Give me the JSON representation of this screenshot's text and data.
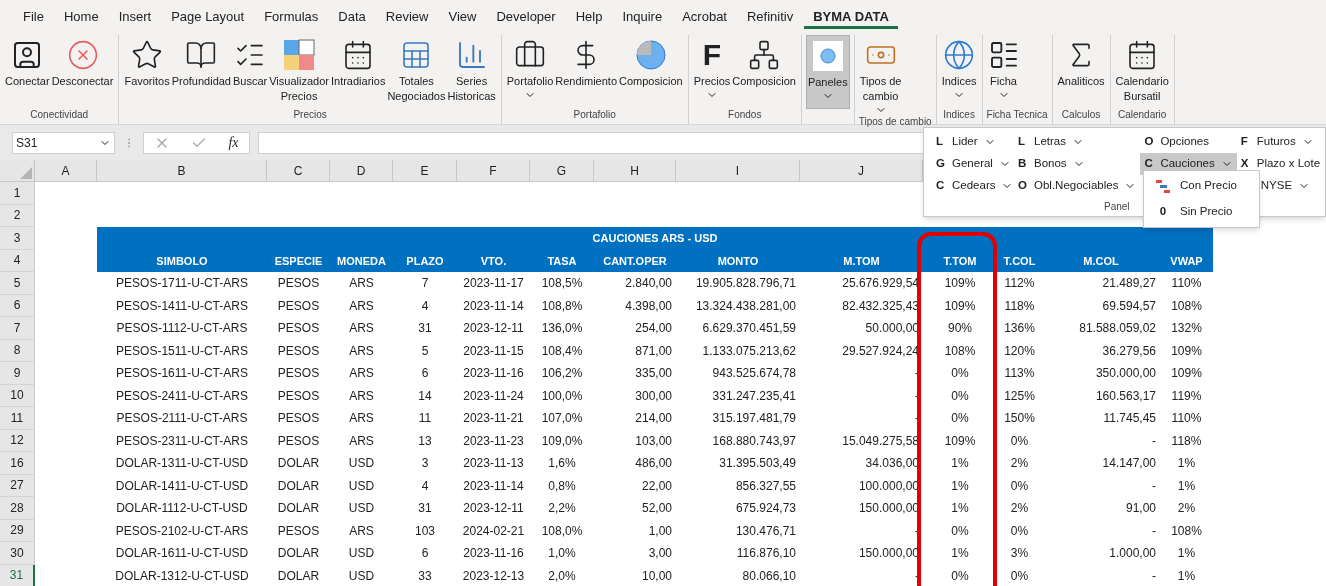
{
  "menu_tabs": [
    {
      "label": "File",
      "selected": false
    },
    {
      "label": "Home",
      "selected": false
    },
    {
      "label": "Insert",
      "selected": false
    },
    {
      "label": "Page Layout",
      "selected": false
    },
    {
      "label": "Formulas",
      "selected": false
    },
    {
      "label": "Data",
      "selected": false
    },
    {
      "label": "Review",
      "selected": false
    },
    {
      "label": "View",
      "selected": false
    },
    {
      "label": "Developer",
      "selected": false
    },
    {
      "label": "Help",
      "selected": false
    },
    {
      "label": "Inquire",
      "selected": false
    },
    {
      "label": "Acrobat",
      "selected": false
    },
    {
      "label": "Refinitiv",
      "selected": false
    },
    {
      "label": "BYMA DATA",
      "selected": true
    }
  ],
  "ribbon_groups": [
    {
      "label": "Conectividad",
      "buttons": [
        {
          "kind": "person",
          "label": "Conectar",
          "dropdown": false,
          "pressed": false
        },
        {
          "kind": "cancel",
          "label": "Desconectar",
          "dropdown": false,
          "pressed": false
        }
      ]
    },
    {
      "label": "Precios",
      "buttons": [
        {
          "kind": "star",
          "label": "Favoritos",
          "dropdown": false,
          "pressed": false
        },
        {
          "kind": "book",
          "label": "Profundidad",
          "dropdown": false,
          "pressed": false
        },
        {
          "kind": "list",
          "label": "Buscar",
          "dropdown": false,
          "pressed": false
        },
        {
          "kind": "quad",
          "label": "Visualizador\nPrecios",
          "dropdown": false,
          "pressed": false
        },
        {
          "kind": "calendar",
          "label": "Intradiarios",
          "dropdown": false,
          "pressed": false
        },
        {
          "kind": "table",
          "label": "Totales\nNegociados",
          "dropdown": false,
          "pressed": false
        },
        {
          "kind": "bars",
          "label": "Series\nHistoricas",
          "dropdown": false,
          "pressed": false
        }
      ]
    },
    {
      "label": "Portafolio",
      "buttons": [
        {
          "kind": "briefcase",
          "label": "Portafolio",
          "dropdown": true,
          "pressed": false
        },
        {
          "kind": "dollar",
          "label": "Rendimiento",
          "dropdown": false,
          "pressed": false
        },
        {
          "kind": "pie",
          "label": "Composicion",
          "dropdown": false,
          "pressed": false
        }
      ]
    },
    {
      "label": "Fondos",
      "buttons": [
        {
          "kind": "letter",
          "glyph": "F",
          "label": "Precios",
          "dropdown": true,
          "pressed": false
        },
        {
          "kind": "diagram",
          "label": "Composicion",
          "dropdown": false,
          "pressed": false
        }
      ]
    },
    {
      "buttons": [
        {
          "kind": "circle",
          "label": "Paneles",
          "dropdown": true,
          "pressed": true
        }
      ]
    },
    {
      "label": "Tipos de cambio",
      "buttons": [
        {
          "kind": "money",
          "label": "Tipos de\ncambio",
          "dropdown": true,
          "pressed": false
        }
      ]
    },
    {
      "label": "Indices",
      "buttons": [
        {
          "kind": "globe",
          "label": "Indices",
          "dropdown": true,
          "pressed": false
        }
      ]
    },
    {
      "label": "Ficha Tecnica",
      "buttons": [
        {
          "kind": "form",
          "label": "Ficha",
          "dropdown": true,
          "pressed": false
        }
      ]
    },
    {
      "label": "Calculos",
      "buttons": [
        {
          "kind": "sigma",
          "label": "Analiticos",
          "dropdown": false,
          "pressed": false
        }
      ]
    },
    {
      "label": "Calendario",
      "buttons": [
        {
          "kind": "calendar",
          "label": "Calendario\nBursatil",
          "dropdown": false,
          "pressed": false
        }
      ]
    }
  ],
  "panel_menu": {
    "columns": [
      [
        {
          "letter": "L",
          "label": "Lider",
          "dropdown": true,
          "selected": false
        },
        {
          "letter": "G",
          "label": "General",
          "dropdown": true,
          "selected": false
        },
        {
          "letter": "C",
          "label": "Cedears",
          "dropdown": true,
          "selected": false
        }
      ],
      [
        {
          "letter": "L",
          "label": "Letras",
          "dropdown": true,
          "selected": false
        },
        {
          "letter": "B",
          "label": "Bonos",
          "dropdown": true,
          "selected": false
        },
        {
          "letter": "O",
          "label": "Obl.Negociables",
          "dropdown": true,
          "selected": false
        }
      ],
      [
        {
          "letter": "O",
          "label": "Opciones",
          "dropdown": false,
          "selected": false
        },
        {
          "letter": "C",
          "label": "Cauciones",
          "dropdown": true,
          "selected": true
        }
      ],
      [
        {
          "letter": "F",
          "label": "Futuros",
          "dropdown": true,
          "selected": false
        },
        {
          "letter": "X",
          "label": "Plazo x Lote",
          "dropdown": false,
          "selected": false
        },
        {
          "label": "NYSE",
          "dropdown": true,
          "selected": false
        }
      ]
    ],
    "footer": "Panel",
    "submenu": [
      {
        "kind": "icon",
        "label": "Con Precio"
      },
      {
        "kind": "letter",
        "letter": "0",
        "label": "Sin Precio"
      }
    ]
  },
  "formula_bar": {
    "name_box": "S31",
    "fx": "fx"
  },
  "column_headers": [
    "A",
    "B",
    "C",
    "D",
    "E",
    "F",
    "G",
    "H",
    "I",
    "J"
  ],
  "row_numbers": [
    {
      "label": "1",
      "selected": false
    },
    {
      "label": "2",
      "selected": false
    },
    {
      "label": "3",
      "selected": false
    },
    {
      "label": "4",
      "selected": false
    },
    {
      "label": "5",
      "selected": false
    },
    {
      "label": "6",
      "selected": false
    },
    {
      "label": "7",
      "selected": false
    },
    {
      "label": "8",
      "selected": false
    },
    {
      "label": "9",
      "selected": false
    },
    {
      "label": "10",
      "selected": false
    },
    {
      "label": "11",
      "selected": false
    },
    {
      "label": "12",
      "selected": false
    },
    {
      "label": "16",
      "selected": false
    },
    {
      "label": "27",
      "selected": false
    },
    {
      "label": "28",
      "selected": false
    },
    {
      "label": "29",
      "selected": false
    },
    {
      "label": "30",
      "selected": false
    },
    {
      "label": "31",
      "selected": true
    }
  ],
  "table": {
    "title": "CAUCIONES ARS - USD",
    "columns": [
      "SIMBOLO",
      "ESPECIE",
      "MONEDA",
      "PLAZO",
      "VTO.",
      "TASA",
      "CANT.OPER",
      "MONTO",
      "M.TOM",
      "T.TOM",
      "T.COL",
      "M.COL",
      "VWAP"
    ],
    "rows": [
      [
        "PESOS-1711-U-CT-ARS",
        "PESOS",
        "ARS",
        "7",
        "2023-11-17",
        "108,5%",
        "2.840,00",
        "19.905.828.796,71",
        "25.676.929,54",
        "109%",
        "112%",
        "21.489,27",
        "110%"
      ],
      [
        "PESOS-1411-U-CT-ARS",
        "PESOS",
        "ARS",
        "4",
        "2023-11-14",
        "108,8%",
        "4.398,00",
        "13.324.438.281,00",
        "82.432.325,43",
        "109%",
        "118%",
        "69.594,57",
        "108%"
      ],
      [
        "PESOS-1112-U-CT-ARS",
        "PESOS",
        "ARS",
        "31",
        "2023-12-11",
        "136,0%",
        "254,00",
        "6.629.370.451,59",
        "50.000,00",
        "90%",
        "136%",
        "81.588.059,02",
        "132%"
      ],
      [
        "PESOS-1511-U-CT-ARS",
        "PESOS",
        "ARS",
        "5",
        "2023-11-15",
        "108,4%",
        "871,00",
        "1.133.075.213,62",
        "29.527.924,24",
        "108%",
        "120%",
        "36.279,56",
        "109%"
      ],
      [
        "PESOS-1611-U-CT-ARS",
        "PESOS",
        "ARS",
        "6",
        "2023-11-16",
        "106,2%",
        "335,00",
        "943.525.674,78",
        "-",
        "0%",
        "113%",
        "350.000,00",
        "109%"
      ],
      [
        "PESOS-2411-U-CT-ARS",
        "PESOS",
        "ARS",
        "14",
        "2023-11-24",
        "100,0%",
        "300,00",
        "331.247.235,41",
        "-",
        "0%",
        "125%",
        "160.563,17",
        "119%"
      ],
      [
        "PESOS-2111-U-CT-ARS",
        "PESOS",
        "ARS",
        "11",
        "2023-11-21",
        "107,0%",
        "214,00",
        "315.197.481,79",
        "-",
        "0%",
        "150%",
        "11.745,45",
        "110%"
      ],
      [
        "PESOS-2311-U-CT-ARS",
        "PESOS",
        "ARS",
        "13",
        "2023-11-23",
        "109,0%",
        "103,00",
        "168.880.743,97",
        "15.049.275,58",
        "109%",
        "0%",
        "-",
        "118%"
      ],
      [
        "DOLAR-1311-U-CT-USD",
        "DOLAR",
        "USD",
        "3",
        "2023-11-13",
        "1,6%",
        "486,00",
        "31.395.503,49",
        "34.036,00",
        "1%",
        "2%",
        "14.147,00",
        "1%"
      ],
      [
        "DOLAR-1411-U-CT-USD",
        "DOLAR",
        "USD",
        "4",
        "2023-11-14",
        "0,8%",
        "22,00",
        "856.327,55",
        "100.000,00",
        "1%",
        "0%",
        "-",
        "1%"
      ],
      [
        "DOLAR-1112-U-CT-USD",
        "DOLAR",
        "USD",
        "31",
        "2023-12-11",
        "2,2%",
        "52,00",
        "675.924,73",
        "150.000,00",
        "1%",
        "2%",
        "91,00",
        "2%"
      ],
      [
        "PESOS-2102-U-CT-ARS",
        "PESOS",
        "ARS",
        "103",
        "2024-02-21",
        "108,0%",
        "1,00",
        "130.476,71",
        "-",
        "0%",
        "0%",
        "-",
        "108%"
      ],
      [
        "DOLAR-1611-U-CT-USD",
        "DOLAR",
        "USD",
        "6",
        "2023-11-16",
        "1,0%",
        "3,00",
        "116.876,10",
        "150.000,00",
        "1%",
        "3%",
        "1.000,00",
        "1%"
      ],
      [
        "DOLAR-1312-U-CT-USD",
        "DOLAR",
        "USD",
        "33",
        "2023-12-13",
        "2,0%",
        "10,00",
        "80.066,10",
        "-",
        "0%",
        "0%",
        "-",
        "1%"
      ]
    ]
  }
}
